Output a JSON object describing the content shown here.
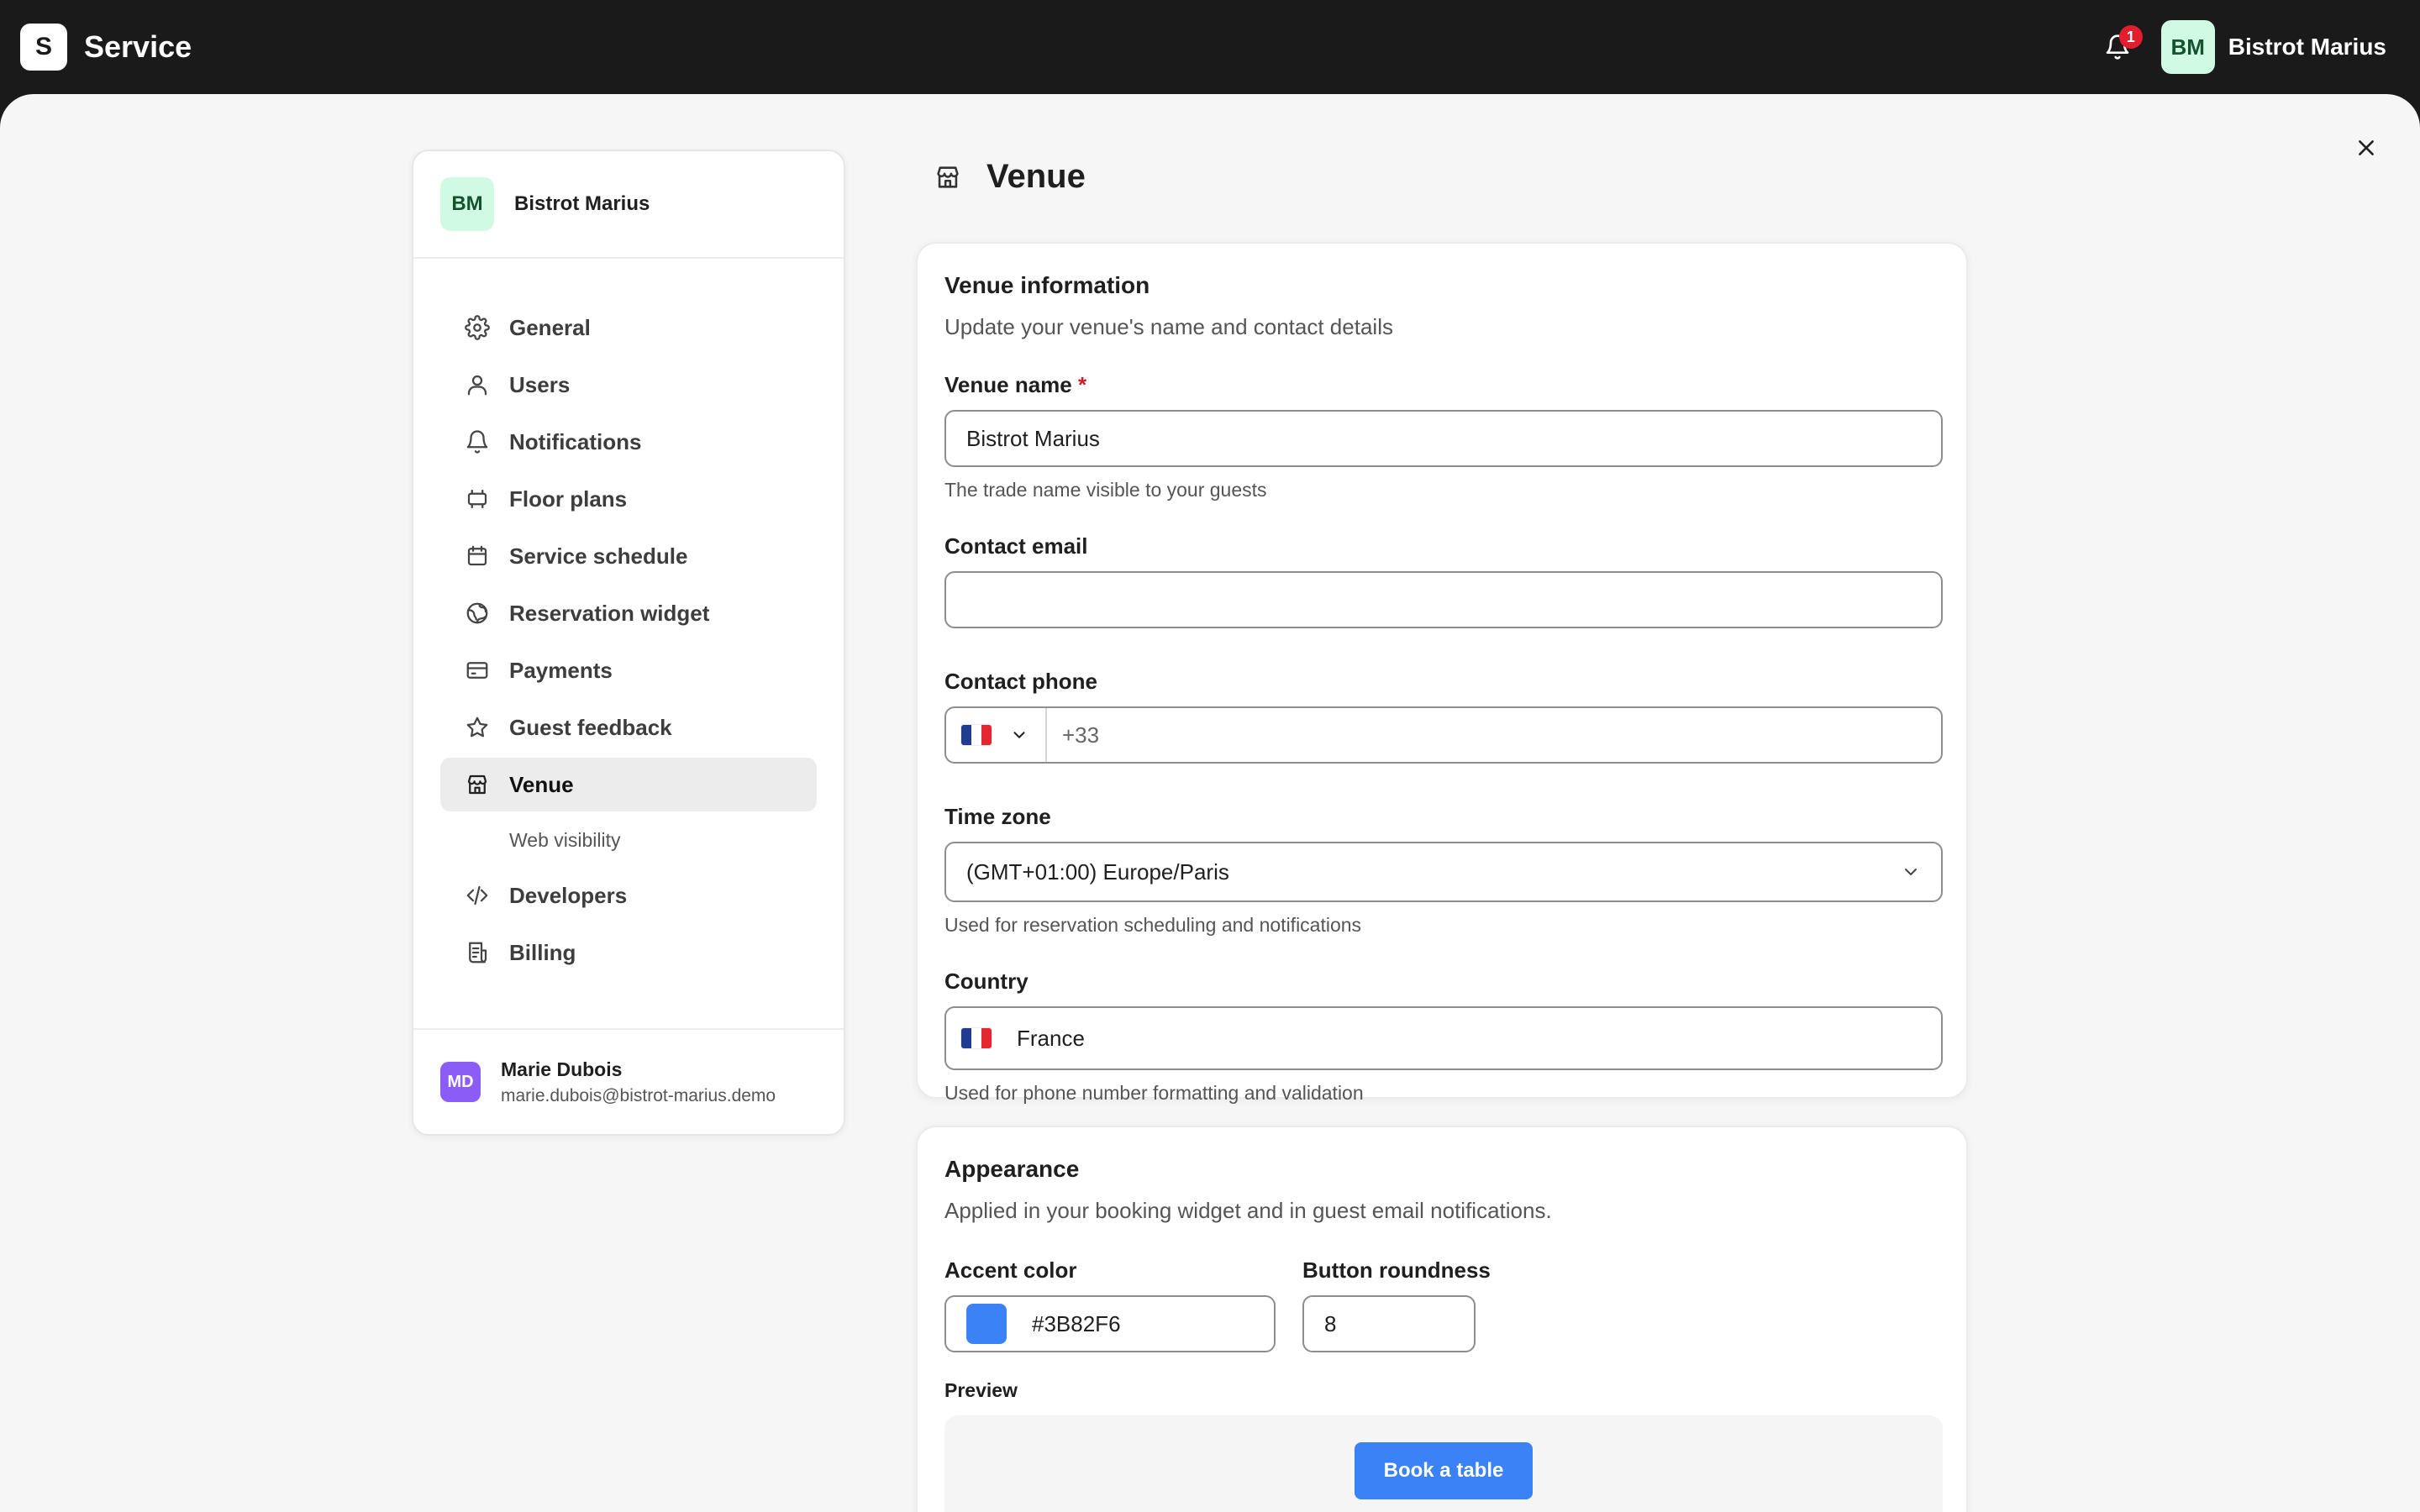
{
  "topbar": {
    "logo_letter": "S",
    "app_name": "Service",
    "notification_count": "1",
    "avatar_initials": "BM",
    "venue_name": "Bistrot Marius"
  },
  "sidebar": {
    "header": {
      "avatar_initials": "BM",
      "venue_name": "Bistrot Marius"
    },
    "items": [
      {
        "label": "General",
        "icon": "gear-icon"
      },
      {
        "label": "Users",
        "icon": "user-icon"
      },
      {
        "label": "Notifications",
        "icon": "bell-icon"
      },
      {
        "label": "Floor plans",
        "icon": "floor-plan-icon"
      },
      {
        "label": "Service schedule",
        "icon": "calendar-icon"
      },
      {
        "label": "Reservation widget",
        "icon": "globe-icon"
      },
      {
        "label": "Payments",
        "icon": "credit-card-icon"
      },
      {
        "label": "Guest feedback",
        "icon": "star-icon"
      },
      {
        "label": "Venue",
        "icon": "store-icon",
        "active": true
      },
      {
        "label": "Developers",
        "icon": "code-icon"
      },
      {
        "label": "Billing",
        "icon": "receipt-icon"
      }
    ],
    "sub_item": "Web visibility",
    "footer": {
      "avatar_initials": "MD",
      "name": "Marie Dubois",
      "email": "marie.dubois@bistrot-marius.demo"
    }
  },
  "page": {
    "title": "Venue",
    "icon": "store-icon"
  },
  "venue_info": {
    "title": "Venue information",
    "subtitle": "Update your venue's name and contact details",
    "venue_name": {
      "label": "Venue name",
      "required_mark": "*",
      "value": "Bistrot Marius",
      "help": "The trade name visible to your guests"
    },
    "contact_email": {
      "label": "Contact email",
      "value": ""
    },
    "contact_phone": {
      "label": "Contact phone",
      "country_flag": "FR",
      "placeholder": "+33"
    },
    "time_zone": {
      "label": "Time zone",
      "value": "(GMT+01:00) Europe/Paris",
      "help": "Used for reservation scheduling and notifications"
    },
    "country": {
      "label": "Country",
      "value": "France",
      "help": "Used for phone number formatting and validation"
    }
  },
  "appearance": {
    "title": "Appearance",
    "subtitle": "Applied in your booking widget and in guest email notifications.",
    "accent_color": {
      "label": "Accent color",
      "value": "#3B82F6"
    },
    "button_roundness": {
      "label": "Button roundness",
      "value": "8"
    },
    "preview": {
      "label": "Preview",
      "button_label": "Book a table"
    }
  },
  "colors": {
    "topbar_bg": "#1a1a1a",
    "accent": "#3B82F6",
    "badge": "#e11d2e",
    "avatar_bm_bg": "#d1fae5",
    "avatar_md_bg": "#8b5cf6"
  }
}
